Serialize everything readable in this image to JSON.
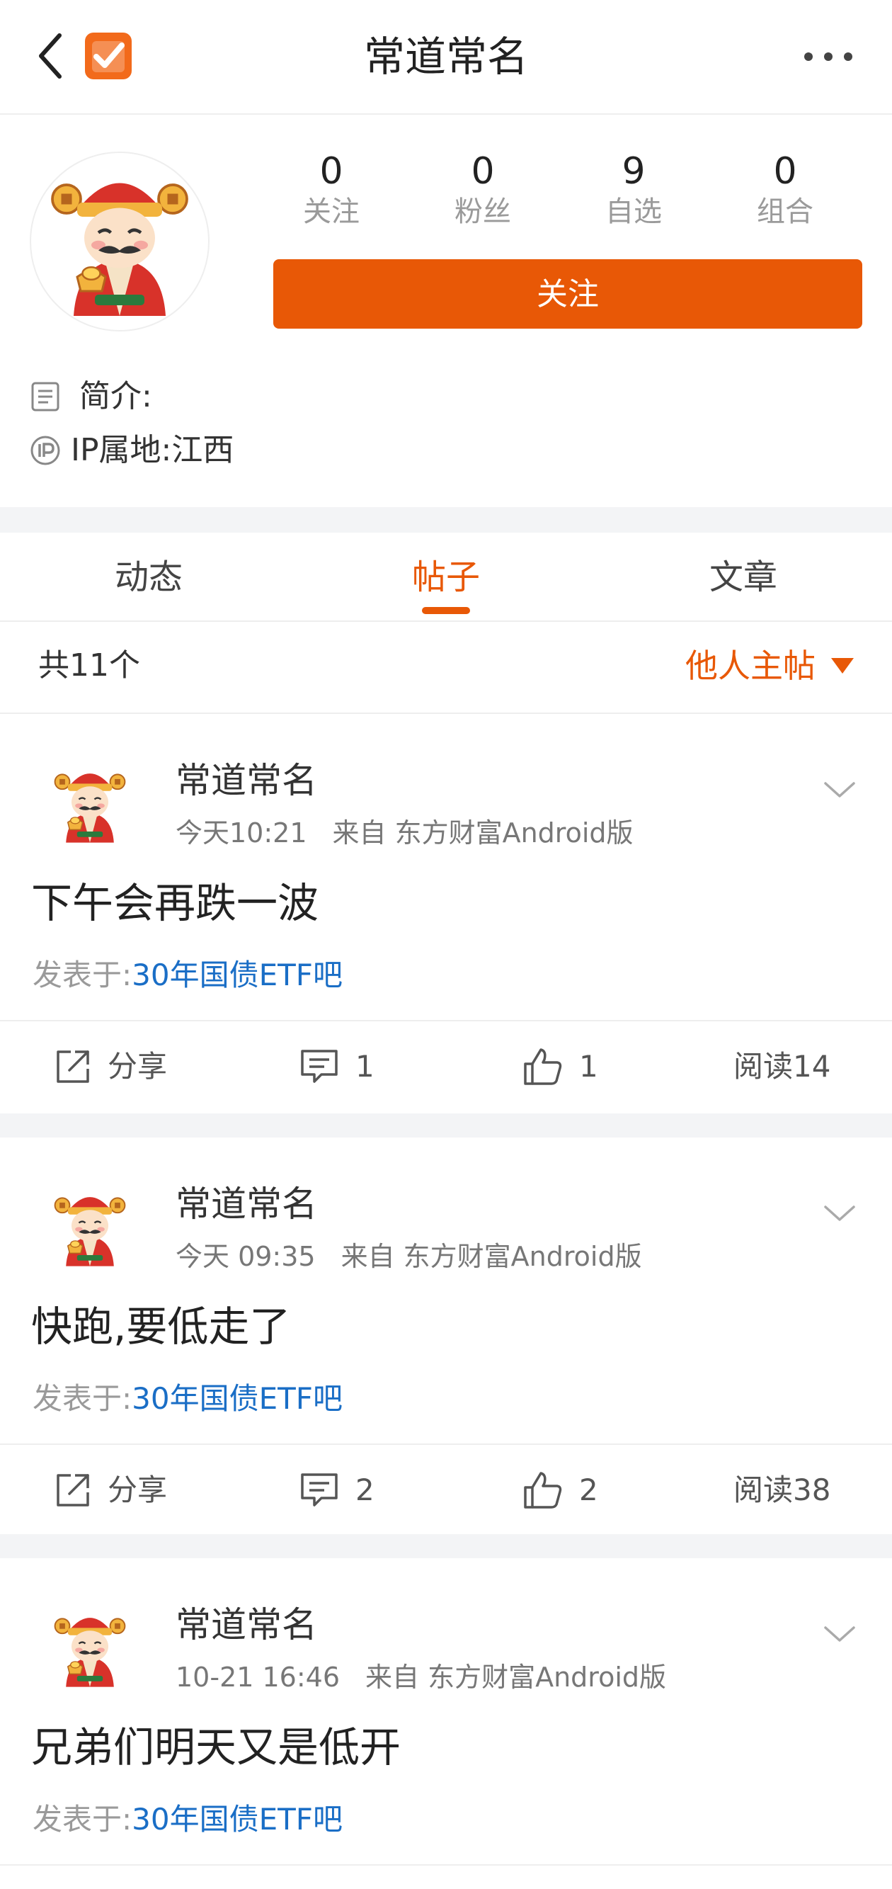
{
  "header": {
    "title": "常道常名"
  },
  "profile": {
    "stats": [
      {
        "value": "0",
        "label": "关注"
      },
      {
        "value": "0",
        "label": "粉丝"
      },
      {
        "value": "9",
        "label": "自选"
      },
      {
        "value": "0",
        "label": "组合"
      }
    ],
    "follow_label": "关注",
    "intro_label": "简介:",
    "ip_label": "IP属地:江西"
  },
  "tabs": [
    {
      "label": "动态",
      "active": false
    },
    {
      "label": "帖子",
      "active": true
    },
    {
      "label": "文章",
      "active": false
    }
  ],
  "list_header": {
    "count_text": "共11个",
    "filter_label": "他人主帖"
  },
  "posts": [
    {
      "author": "常道常名",
      "time": "今天10:21",
      "source": "来自 东方财富Android版",
      "content": "下午会再跌一波",
      "from_label": "发表于:",
      "forum": "30年国债ETF吧",
      "share_label": "分享",
      "comments": "1",
      "likes": "1",
      "reads": "阅读14"
    },
    {
      "author": "常道常名",
      "time": "今天 09:35",
      "source": "来自 东方财富Android版",
      "content": "快跑,要低走了",
      "from_label": "发表于:",
      "forum": "30年国债ETF吧",
      "share_label": "分享",
      "comments": "2",
      "likes": "2",
      "reads": "阅读38"
    },
    {
      "author": "常道常名",
      "time": "10-21 16:46",
      "source": "来自 东方财富Android版",
      "content": "兄弟们明天又是低开",
      "from_label": "发表于:",
      "forum": "30年国债ETF吧"
    }
  ],
  "colors": {
    "accent": "#e85806",
    "link": "#1a6ec6"
  },
  "icons": [
    "back-arrow-icon",
    "app-logo-icon",
    "more-dots-icon",
    "intro-doc-icon",
    "ip-icon",
    "chevron-down-icon",
    "share-icon",
    "comment-icon",
    "thumbs-up-icon"
  ]
}
